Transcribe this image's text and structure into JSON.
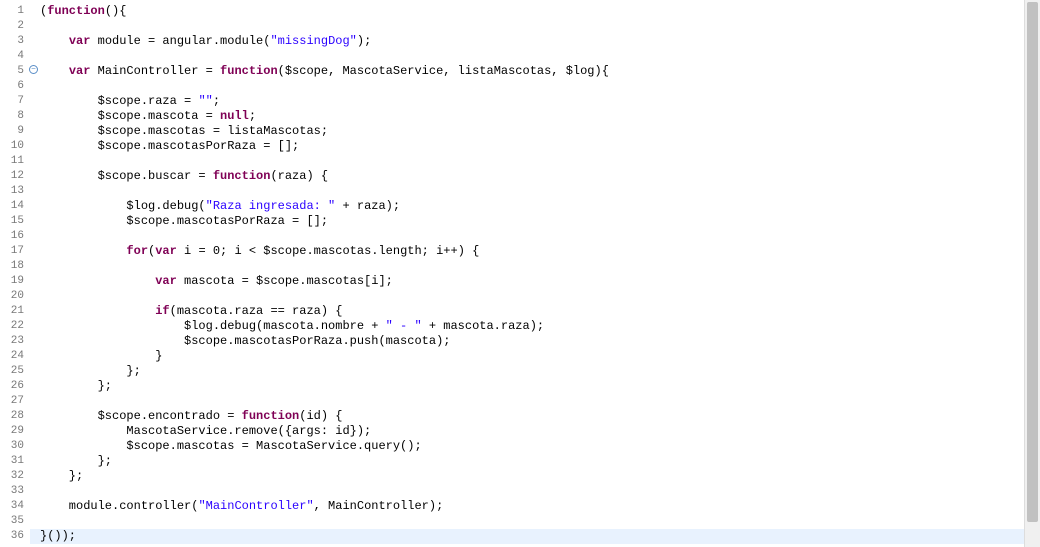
{
  "lines": [
    {
      "num": 1,
      "fold": false,
      "hl": false,
      "tokens": [
        {
          "c": "pn",
          "t": "("
        },
        {
          "c": "kw",
          "t": "function"
        },
        {
          "c": "pn",
          "t": "(){"
        }
      ]
    },
    {
      "num": 2,
      "fold": false,
      "hl": false,
      "tokens": []
    },
    {
      "num": 3,
      "fold": false,
      "hl": false,
      "tokens": [
        {
          "c": "pn",
          "t": "    "
        },
        {
          "c": "kw",
          "t": "var"
        },
        {
          "c": "pn",
          "t": " module = angular.module("
        },
        {
          "c": "str",
          "t": "\"missingDog\""
        },
        {
          "c": "pn",
          "t": ");"
        }
      ]
    },
    {
      "num": 4,
      "fold": false,
      "hl": false,
      "tokens": []
    },
    {
      "num": 5,
      "fold": true,
      "hl": false,
      "tokens": [
        {
          "c": "pn",
          "t": "    "
        },
        {
          "c": "kw",
          "t": "var"
        },
        {
          "c": "pn",
          "t": " MainController = "
        },
        {
          "c": "kw",
          "t": "function"
        },
        {
          "c": "pn",
          "t": "($scope, MascotaService, listaMascotas, $log){"
        }
      ]
    },
    {
      "num": 6,
      "fold": false,
      "hl": false,
      "tokens": []
    },
    {
      "num": 7,
      "fold": false,
      "hl": false,
      "tokens": [
        {
          "c": "pn",
          "t": "        $scope.raza = "
        },
        {
          "c": "str",
          "t": "\"\""
        },
        {
          "c": "pn",
          "t": ";"
        }
      ]
    },
    {
      "num": 8,
      "fold": false,
      "hl": false,
      "tokens": [
        {
          "c": "pn",
          "t": "        $scope.mascota = "
        },
        {
          "c": "kw",
          "t": "null"
        },
        {
          "c": "pn",
          "t": ";"
        }
      ]
    },
    {
      "num": 9,
      "fold": false,
      "hl": false,
      "tokens": [
        {
          "c": "pn",
          "t": "        $scope.mascotas = listaMascotas;"
        }
      ]
    },
    {
      "num": 10,
      "fold": false,
      "hl": false,
      "tokens": [
        {
          "c": "pn",
          "t": "        $scope.mascotasPorRaza = [];"
        }
      ]
    },
    {
      "num": 11,
      "fold": false,
      "hl": false,
      "tokens": []
    },
    {
      "num": 12,
      "fold": false,
      "hl": false,
      "tokens": [
        {
          "c": "pn",
          "t": "        $scope.buscar = "
        },
        {
          "c": "kw",
          "t": "function"
        },
        {
          "c": "pn",
          "t": "(raza) {"
        }
      ]
    },
    {
      "num": 13,
      "fold": false,
      "hl": false,
      "tokens": []
    },
    {
      "num": 14,
      "fold": false,
      "hl": false,
      "tokens": [
        {
          "c": "pn",
          "t": "            $log.debug("
        },
        {
          "c": "str",
          "t": "\"Raza ingresada: \""
        },
        {
          "c": "pn",
          "t": " + raza);"
        }
      ]
    },
    {
      "num": 15,
      "fold": false,
      "hl": false,
      "tokens": [
        {
          "c": "pn",
          "t": "            $scope.mascotasPorRaza = [];"
        }
      ]
    },
    {
      "num": 16,
      "fold": false,
      "hl": false,
      "tokens": []
    },
    {
      "num": 17,
      "fold": false,
      "hl": false,
      "tokens": [
        {
          "c": "pn",
          "t": "            "
        },
        {
          "c": "kw",
          "t": "for"
        },
        {
          "c": "pn",
          "t": "("
        },
        {
          "c": "kw",
          "t": "var"
        },
        {
          "c": "pn",
          "t": " i = 0; i < $scope.mascotas.length; i++) {"
        }
      ]
    },
    {
      "num": 18,
      "fold": false,
      "hl": false,
      "tokens": []
    },
    {
      "num": 19,
      "fold": false,
      "hl": false,
      "tokens": [
        {
          "c": "pn",
          "t": "                "
        },
        {
          "c": "kw",
          "t": "var"
        },
        {
          "c": "pn",
          "t": " mascota = $scope.mascotas[i];"
        }
      ]
    },
    {
      "num": 20,
      "fold": false,
      "hl": false,
      "tokens": []
    },
    {
      "num": 21,
      "fold": false,
      "hl": false,
      "tokens": [
        {
          "c": "pn",
          "t": "                "
        },
        {
          "c": "kw",
          "t": "if"
        },
        {
          "c": "pn",
          "t": "(mascota.raza == raza) {"
        }
      ]
    },
    {
      "num": 22,
      "fold": false,
      "hl": false,
      "tokens": [
        {
          "c": "pn",
          "t": "                    $log.debug(mascota.nombre + "
        },
        {
          "c": "str",
          "t": "\" - \""
        },
        {
          "c": "pn",
          "t": " + mascota.raza);"
        }
      ]
    },
    {
      "num": 23,
      "fold": false,
      "hl": false,
      "tokens": [
        {
          "c": "pn",
          "t": "                    $scope.mascotasPorRaza.push(mascota);"
        }
      ]
    },
    {
      "num": 24,
      "fold": false,
      "hl": false,
      "tokens": [
        {
          "c": "pn",
          "t": "                }"
        }
      ]
    },
    {
      "num": 25,
      "fold": false,
      "hl": false,
      "tokens": [
        {
          "c": "pn",
          "t": "            };"
        }
      ]
    },
    {
      "num": 26,
      "fold": false,
      "hl": false,
      "tokens": [
        {
          "c": "pn",
          "t": "        };"
        }
      ]
    },
    {
      "num": 27,
      "fold": false,
      "hl": false,
      "tokens": []
    },
    {
      "num": 28,
      "fold": false,
      "hl": false,
      "tokens": [
        {
          "c": "pn",
          "t": "        $scope.encontrado = "
        },
        {
          "c": "kw",
          "t": "function"
        },
        {
          "c": "pn",
          "t": "(id) {"
        }
      ]
    },
    {
      "num": 29,
      "fold": false,
      "hl": false,
      "tokens": [
        {
          "c": "pn",
          "t": "            MascotaService.remove({args: id});"
        }
      ]
    },
    {
      "num": 30,
      "fold": false,
      "hl": false,
      "tokens": [
        {
          "c": "pn",
          "t": "            $scope.mascotas = MascotaService.query();"
        }
      ]
    },
    {
      "num": 31,
      "fold": false,
      "hl": false,
      "tokens": [
        {
          "c": "pn",
          "t": "        };"
        }
      ]
    },
    {
      "num": 32,
      "fold": false,
      "hl": false,
      "tokens": [
        {
          "c": "pn",
          "t": "    };"
        }
      ]
    },
    {
      "num": 33,
      "fold": false,
      "hl": false,
      "tokens": []
    },
    {
      "num": 34,
      "fold": false,
      "hl": false,
      "tokens": [
        {
          "c": "pn",
          "t": "    module.controller("
        },
        {
          "c": "str",
          "t": "\"MainController\""
        },
        {
          "c": "pn",
          "t": ", MainController);"
        }
      ]
    },
    {
      "num": 35,
      "fold": false,
      "hl": false,
      "tokens": []
    },
    {
      "num": 36,
      "fold": false,
      "hl": true,
      "tokens": [
        {
          "c": "pn",
          "t": "}());"
        }
      ]
    }
  ]
}
